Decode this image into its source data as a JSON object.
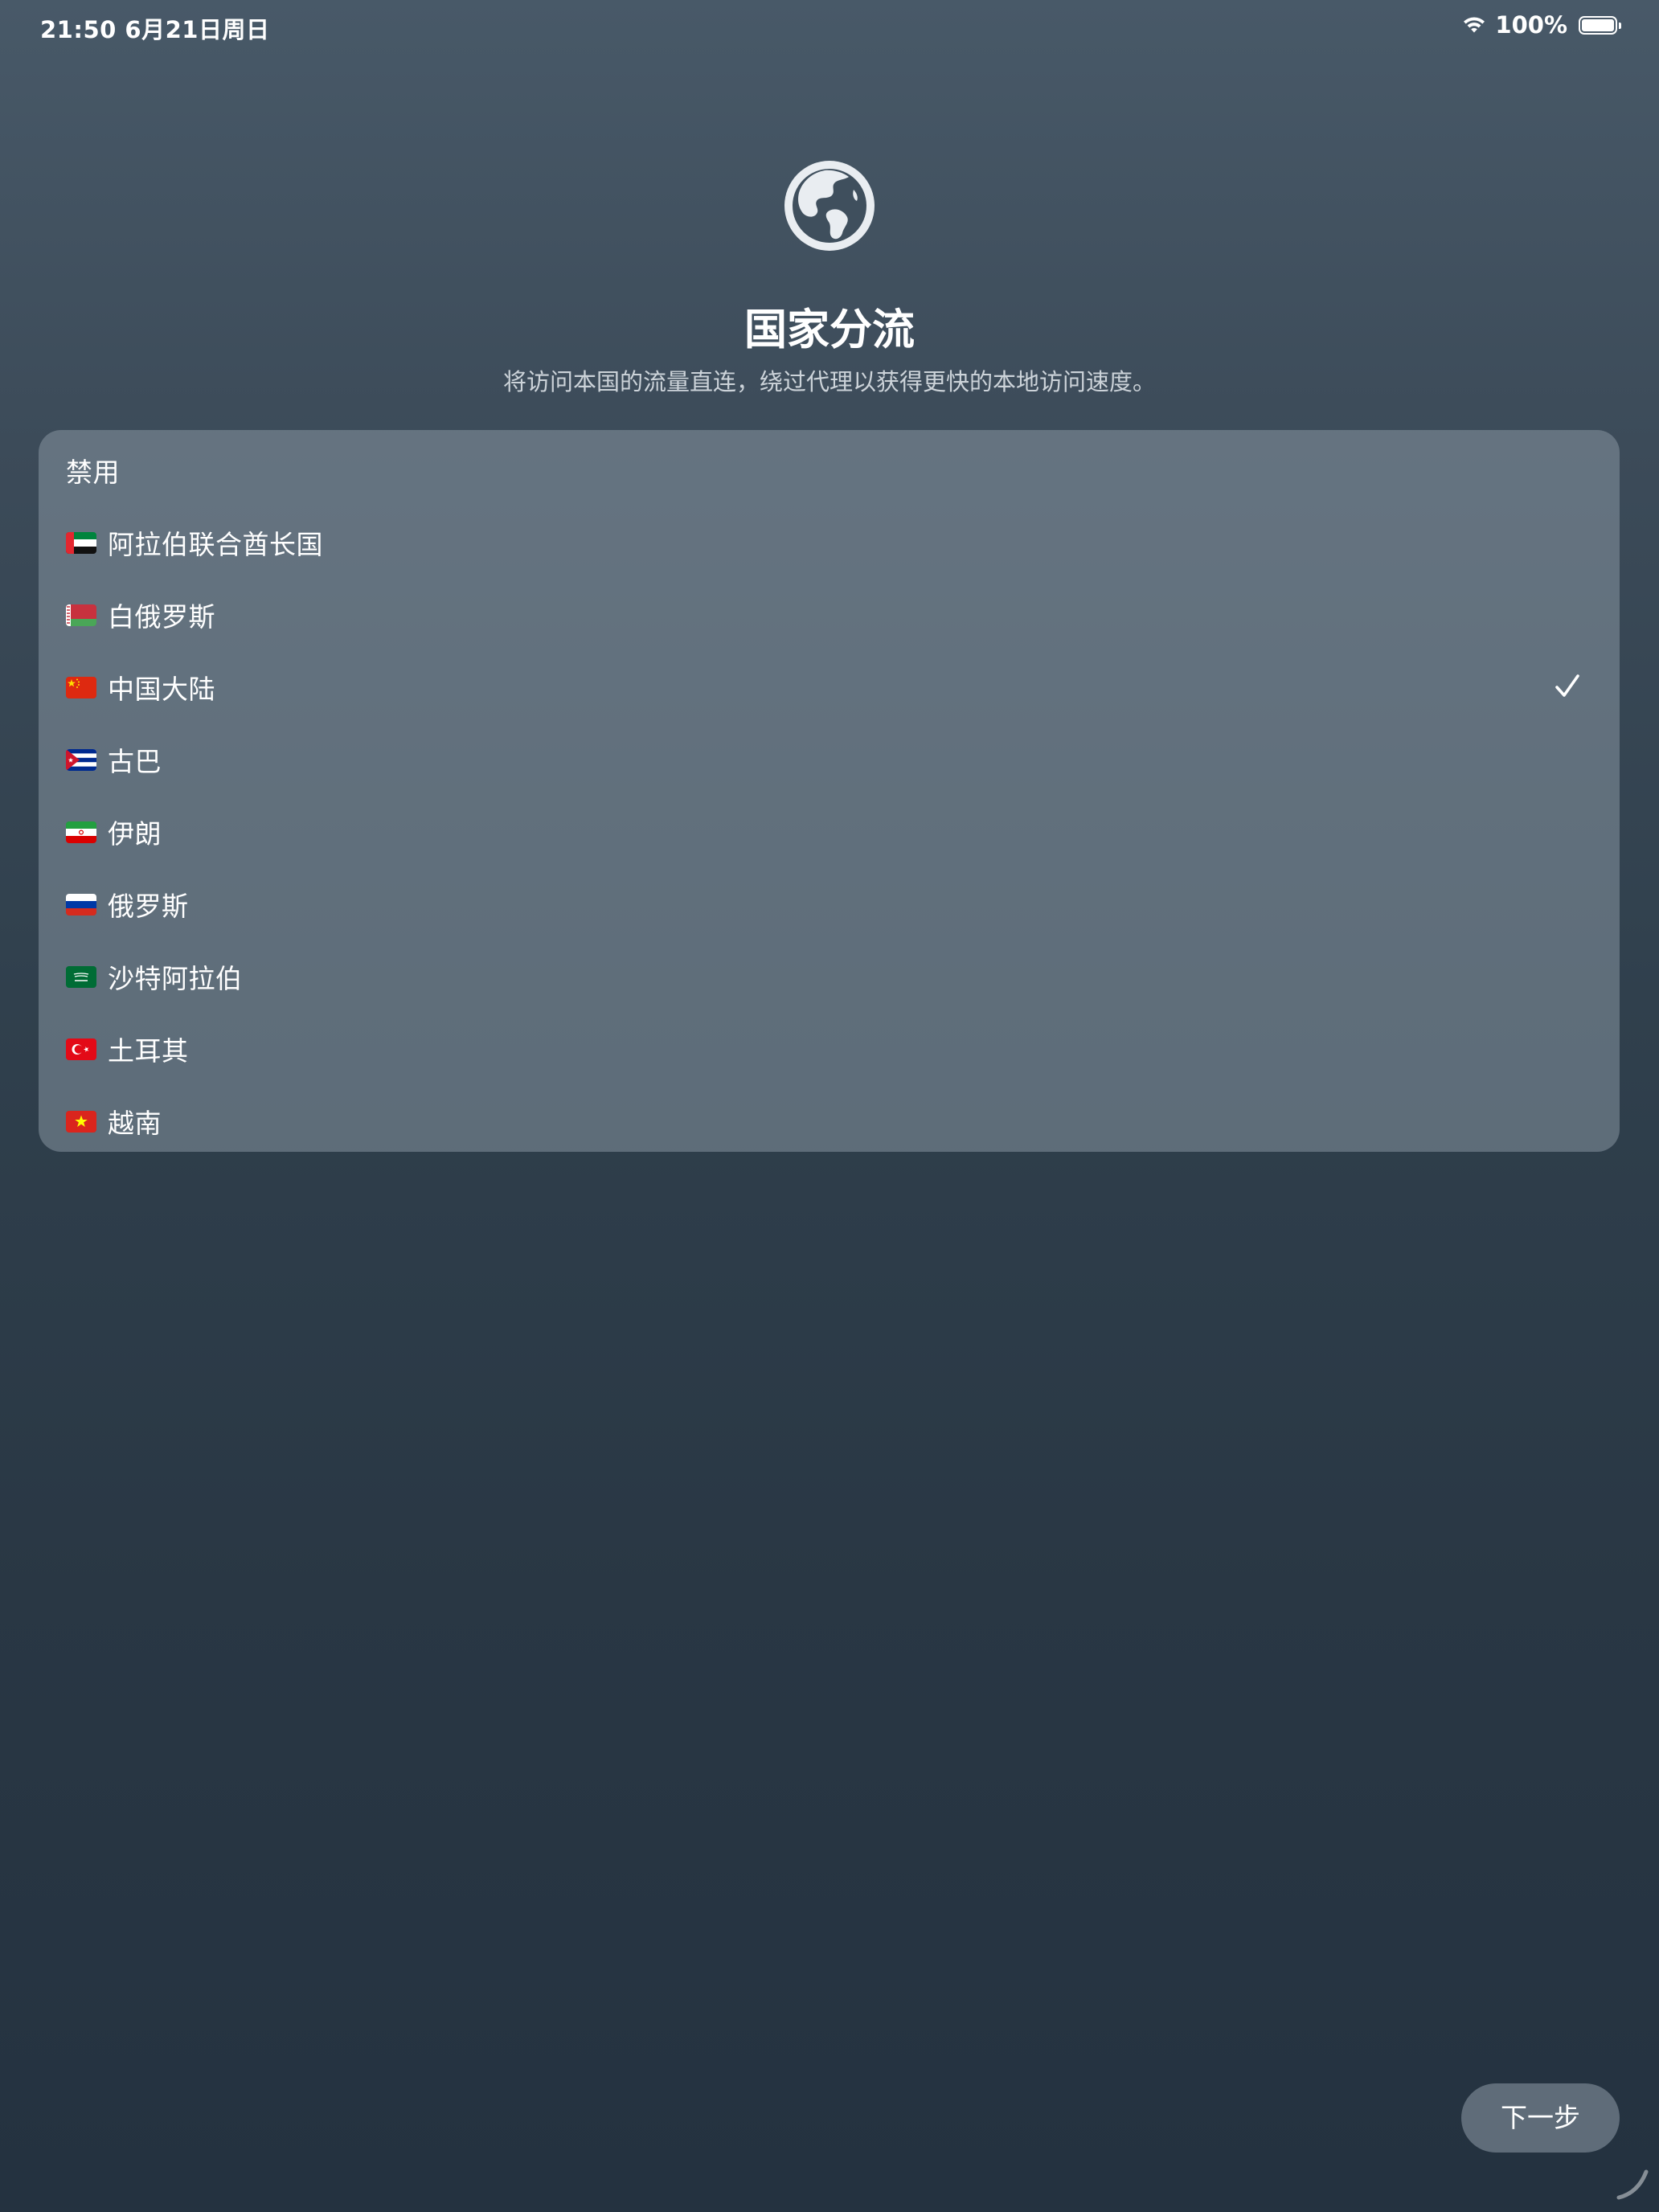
{
  "status_bar": {
    "time_date": "21:50   6月21日周日",
    "battery_percent": "100%",
    "battery_level": 1.0
  },
  "header": {
    "icon": "globe-americas-icon",
    "title": "国家分流",
    "subtitle": "将访问本国的流量直连，绕过代理以获得更快的本地访问速度。"
  },
  "options": {
    "disabled_label": "禁用",
    "selected": "中国大陆",
    "countries": [
      {
        "flag": "ae",
        "label": "阿拉伯联合酋长国"
      },
      {
        "flag": "by",
        "label": "白俄罗斯"
      },
      {
        "flag": "cn",
        "label": "中国大陆"
      },
      {
        "flag": "cu",
        "label": "古巴"
      },
      {
        "flag": "ir",
        "label": "伊朗"
      },
      {
        "flag": "ru",
        "label": "俄罗斯"
      },
      {
        "flag": "sa",
        "label": "沙特阿拉伯"
      },
      {
        "flag": "tr",
        "label": "土耳其"
      },
      {
        "flag": "vn",
        "label": "越南"
      }
    ]
  },
  "footer": {
    "next_label": "下一步"
  },
  "colors": {
    "check": "#ffffff",
    "card_bg": "rgba(142,156,168,0.5)"
  }
}
